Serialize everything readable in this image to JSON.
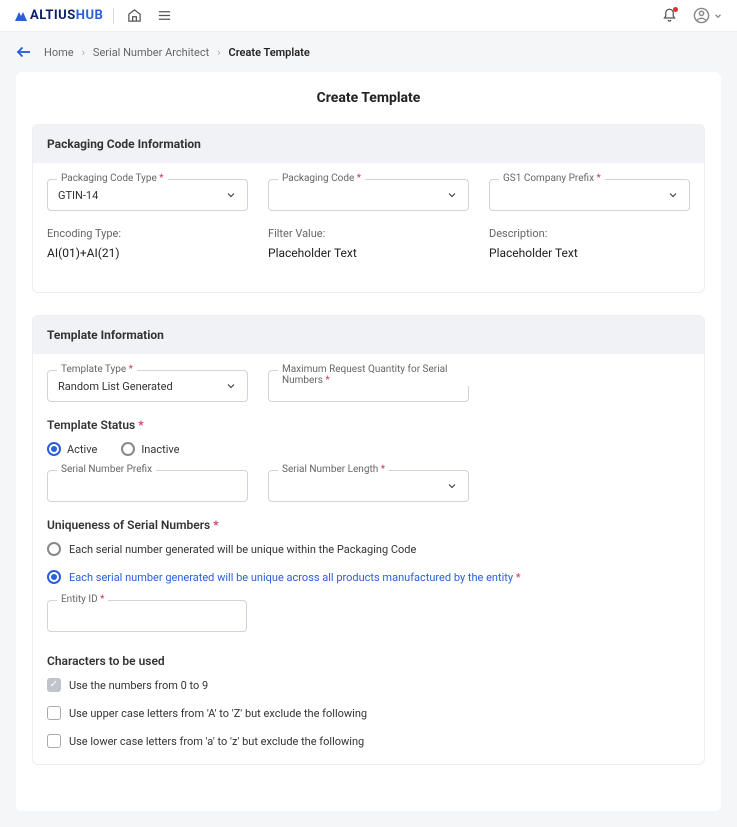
{
  "topbar": {
    "logo_altius": "ALTIUS",
    "logo_hub": "HUB"
  },
  "breadcrumb": {
    "home": "Home",
    "l1": "Serial Number Architect",
    "current": "Create Template"
  },
  "page_title": "Create Template",
  "pkg": {
    "section_title": "Packaging Code Information",
    "code_type_label": "Packaging Code Type",
    "code_type_value": "GTIN-14",
    "code_label": "Packaging Code",
    "code_value": "",
    "prefix_label": "GS1 Company Prefix",
    "prefix_value": "",
    "encoding_label": "Encoding Type:",
    "encoding_value": "AI(01)+AI(21)",
    "filter_label": "Filter Value:",
    "filter_value": "Placeholder Text",
    "desc_label": "Description:",
    "desc_value": "Placeholder Text"
  },
  "tmpl": {
    "section_title": "Template Information",
    "type_label": "Template Type",
    "type_value": "Random List Generated",
    "maxqty_label": "Maximum Request Quantity for Serial Numbers",
    "maxqty_value": "",
    "status_label": "Template Status",
    "status_active": "Active",
    "status_inactive": "Inactive",
    "prefix_label": "Serial Number Prefix",
    "prefix_value": "",
    "len_label": "Serial Number Length",
    "len_value": "",
    "uniq_label": "Uniqueness of Serial Numbers",
    "uniq_opt1": "Each serial number generated will be unique within the Packaging Code",
    "uniq_opt2": "Each serial number generated will be unique across all products manufactured by the entity",
    "entity_label": "Entity ID",
    "entity_value": "",
    "chars_label": "Characters to be used",
    "chars_opt1": "Use the numbers from 0 to 9",
    "chars_opt2": "Use upper case letters from 'A' to 'Z' but exclude the following",
    "chars_opt3": "Use lower case letters from 'a' to 'z' but exclude the following"
  }
}
